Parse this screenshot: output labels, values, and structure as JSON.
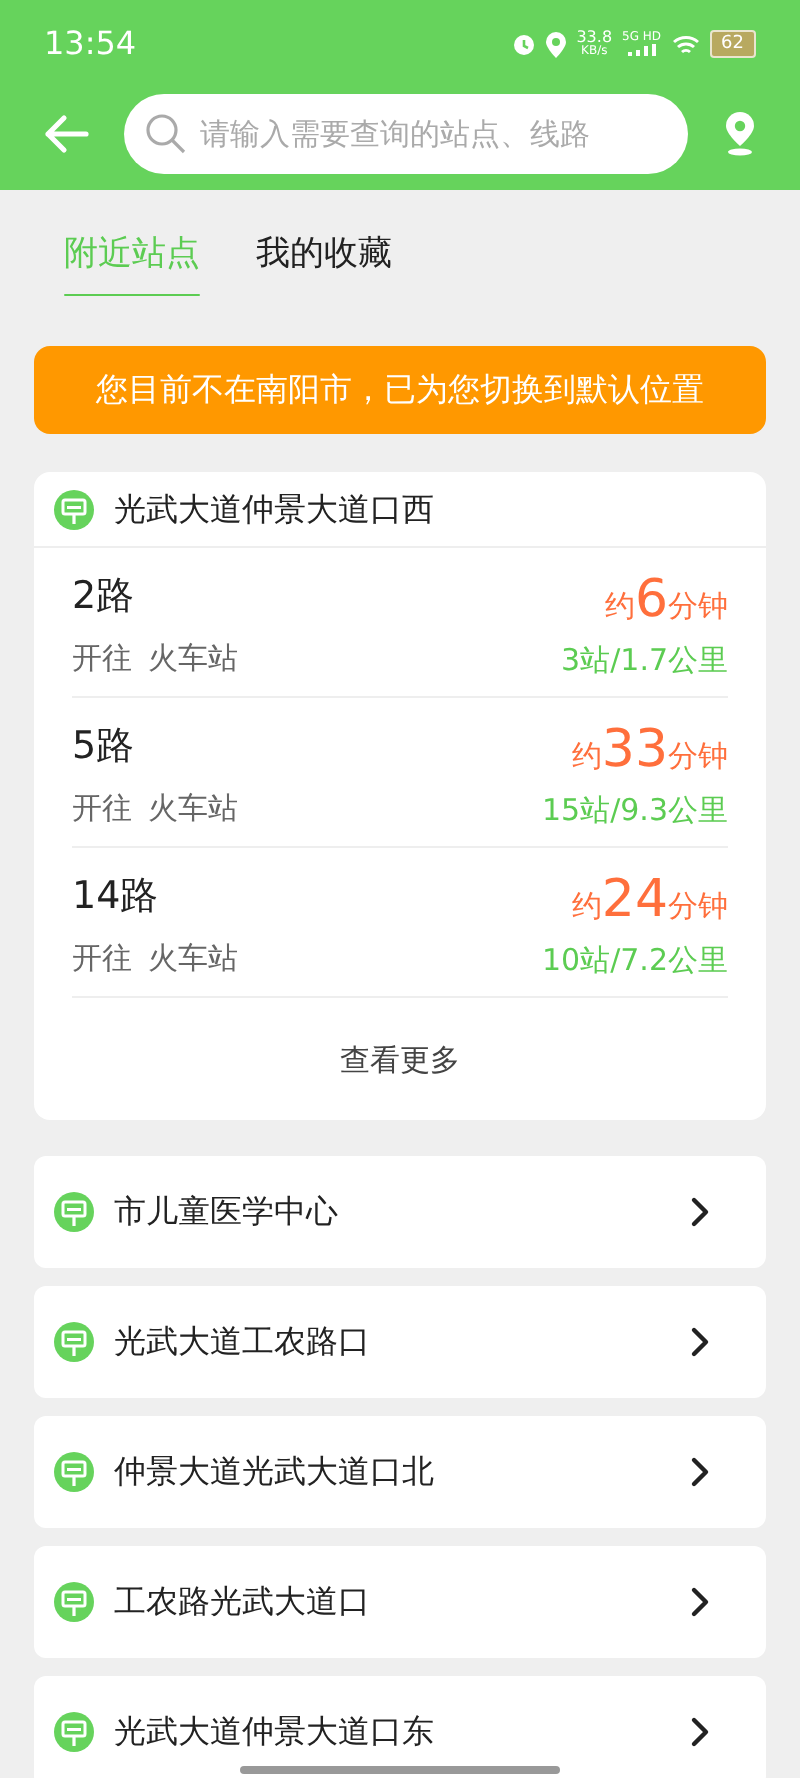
{
  "status_bar": {
    "time": "13:54",
    "speed": "33.8",
    "speed_unit": "KB/s",
    "network": "5G HD",
    "battery": "62"
  },
  "search": {
    "placeholder": "请输入需要查询的站点、线路"
  },
  "tabs": [
    {
      "label": "附近站点",
      "selected": true
    },
    {
      "label": "我的收藏",
      "selected": false
    }
  ],
  "notice": "您目前不在南阳市，已为您切换到默认位置",
  "nearest_stop": {
    "name": "光武大道仲景大道口西",
    "routes": [
      {
        "route": "2路",
        "direction_label": "开往",
        "destination": "火车站",
        "eta_prefix": "约",
        "eta_value": "6",
        "eta_unit": "分钟",
        "distance": "3站/1.7公里"
      },
      {
        "route": "5路",
        "direction_label": "开往",
        "destination": "火车站",
        "eta_prefix": "约",
        "eta_value": "33",
        "eta_unit": "分钟",
        "distance": "15站/9.3公里"
      },
      {
        "route": "14路",
        "direction_label": "开往",
        "destination": "火车站",
        "eta_prefix": "约",
        "eta_value": "24",
        "eta_unit": "分钟",
        "distance": "10站/7.2公里"
      }
    ],
    "more": "查看更多"
  },
  "stops": [
    {
      "name": "市儿童医学中心"
    },
    {
      "name": "光武大道工农路口"
    },
    {
      "name": "仲景大道光武大道口北"
    },
    {
      "name": "工农路光武大道口"
    },
    {
      "name": "光武大道仲景大道口东"
    }
  ]
}
